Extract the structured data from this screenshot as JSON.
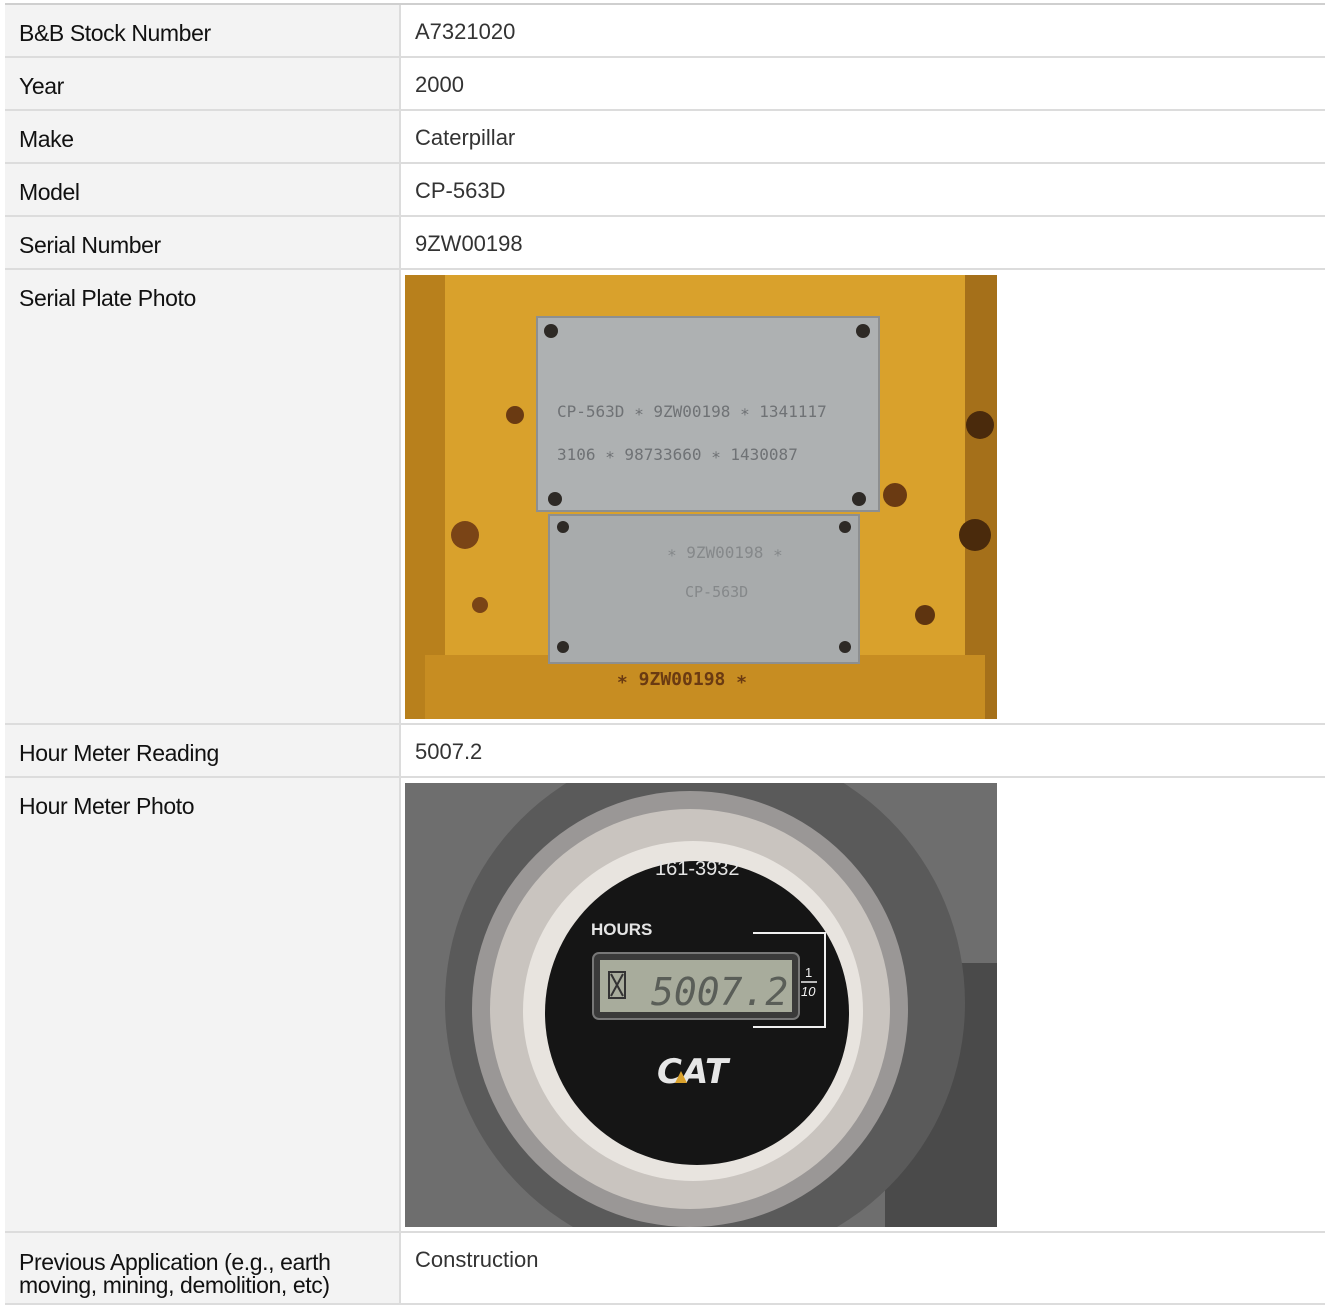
{
  "rows": [
    {
      "label": "B&B Stock Number",
      "value": "A7321020"
    },
    {
      "label": "Year",
      "value": "2000"
    },
    {
      "label": "Make",
      "value": "Caterpillar"
    },
    {
      "label": "Model",
      "value": "CP-563D"
    },
    {
      "label": "Serial Number",
      "value": "9ZW00198"
    }
  ],
  "serial_plate": {
    "label": "Serial Plate Photo",
    "plate_line1": "CP-563D ∗ 9ZW00198 ∗ 1341117",
    "plate_line2": "3106 ∗ 98733660 ∗ 1430087",
    "plate_lower": "∗ 9ZW00198 ∗",
    "plate_lower_model": "CP-563D",
    "stamped_serial": "∗ 9ZW00198 ∗"
  },
  "hour_meter": {
    "label": "Hour Meter Reading",
    "value": "5007.2"
  },
  "hour_meter_photo": {
    "label": "Hour Meter Photo",
    "part_number": "161-3932",
    "hours_label": "HOURS",
    "display_value": "5007.2",
    "tenths_top": "1",
    "tenths_bottom": "10",
    "brand": "CAT"
  },
  "application": {
    "label": "Previous Application (e.g., earth moving, mining, demolition, etc)",
    "value": "Construction"
  }
}
